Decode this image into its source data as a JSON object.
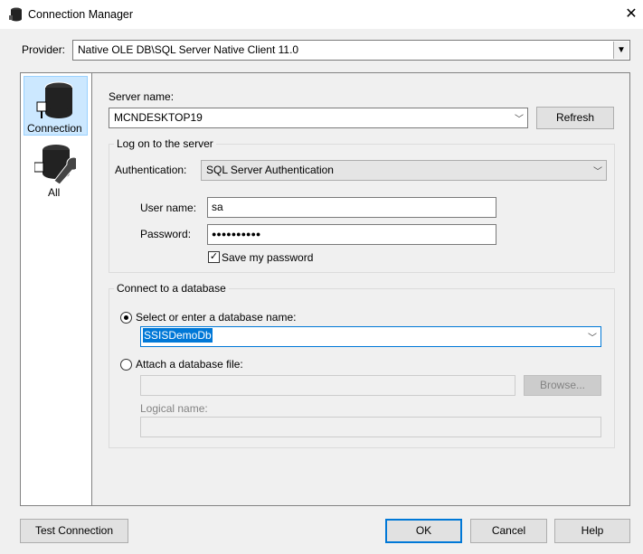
{
  "window": {
    "title": "Connection Manager",
    "close": "✕"
  },
  "provider": {
    "label": "Provider:",
    "value": "Native OLE DB\\SQL Server Native Client 11.0"
  },
  "sidebar": {
    "items": [
      {
        "label": "Connection",
        "selected": true
      },
      {
        "label": "All",
        "selected": false
      }
    ]
  },
  "server": {
    "label": "Server name:",
    "value": "MCNDESKTOP19",
    "refresh": "Refresh"
  },
  "logon": {
    "legend": "Log on to the server",
    "auth_label": "Authentication:",
    "auth_value": "SQL Server Authentication",
    "user_label": "User name:",
    "user_value": "sa",
    "password_label": "Password:",
    "password_value": "●●●●●●●●●●",
    "save_password": "Save my password",
    "save_checked": true
  },
  "database": {
    "legend": "Connect to a database",
    "select_label": "Select or enter a database name:",
    "select_value": "SSISDemoDb",
    "attach_label": "Attach a database file:",
    "browse": "Browse...",
    "logical_label": "Logical name:"
  },
  "buttons": {
    "test": "Test Connection",
    "ok": "OK",
    "cancel": "Cancel",
    "help": "Help"
  },
  "colors": {
    "accent": "#0078d7",
    "selected_bg": "#cce8ff"
  }
}
